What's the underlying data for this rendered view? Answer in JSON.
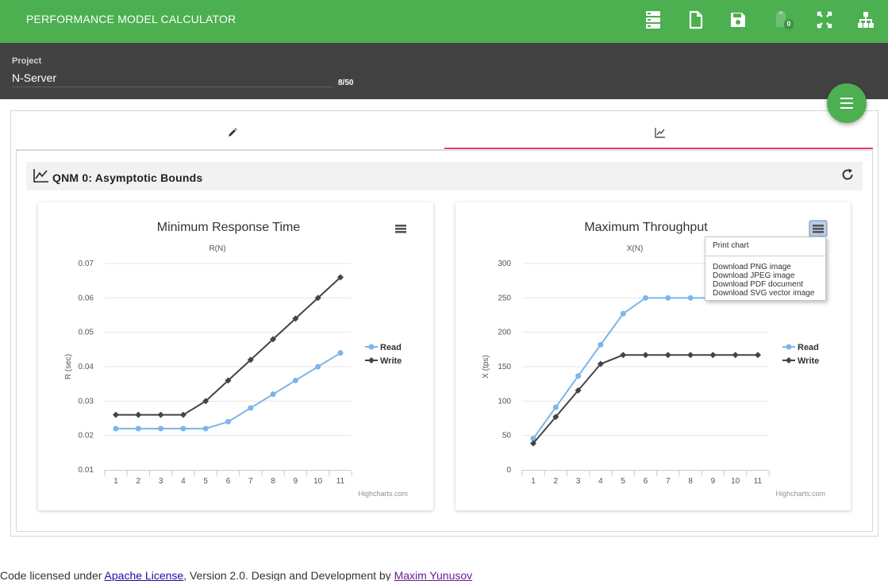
{
  "app": {
    "title": "PERFORMANCE MODEL CALCULATOR",
    "toolbar_icons": [
      "server-icon",
      "new-file-icon",
      "save-icon",
      "clipboard-icon",
      "fullscreen-icon",
      "sitemap-icon"
    ],
    "clipboard_count": "0"
  },
  "project": {
    "label": "Project",
    "value": "N-Server",
    "counter": "8/50"
  },
  "tabs": [
    {
      "icon": "pencil-icon",
      "active": false
    },
    {
      "icon": "line-chart-icon",
      "active": true
    }
  ],
  "section": {
    "title": "QNM 0: Asymptotic Bounds",
    "icon": "area-chart-icon"
  },
  "chart_menu": {
    "print": "Print chart",
    "downloads": [
      "Download PNG image",
      "Download JPEG image",
      "Download PDF document",
      "Download SVG vector image"
    ]
  },
  "chart_data": [
    {
      "type": "line",
      "title": "Minimum Response Time",
      "subtitle": "R(N)",
      "ylabel": "R (sec)",
      "xlabel": "",
      "x": [
        1,
        2,
        3,
        4,
        5,
        6,
        7,
        8,
        9,
        10,
        11
      ],
      "ylim": [
        0.01,
        0.07
      ],
      "yticks": [
        "0.01",
        "0.02",
        "0.03",
        "0.04",
        "0.05",
        "0.06",
        "0.07"
      ],
      "grid": true,
      "legend": "right",
      "credit": "Highcharts.com",
      "series": [
        {
          "name": "Read",
          "color": "#7cb5ec",
          "marker": "circle",
          "values": [
            0.022,
            0.022,
            0.022,
            0.022,
            0.022,
            0.024,
            0.028,
            0.032,
            0.036,
            0.04,
            0.044
          ]
        },
        {
          "name": "Write",
          "color": "#434348",
          "marker": "diamond",
          "values": [
            0.026,
            0.026,
            0.026,
            0.026,
            0.03,
            0.036,
            0.042,
            0.048,
            0.054,
            0.06,
            0.066
          ]
        }
      ]
    },
    {
      "type": "line",
      "title": "Maximum Throughput",
      "subtitle": "X(N)",
      "ylabel": "X (tps)",
      "xlabel": "",
      "x": [
        1,
        2,
        3,
        4,
        5,
        6,
        7,
        8,
        9,
        10,
        11
      ],
      "ylim": [
        0,
        300
      ],
      "yticks": [
        "0",
        "50",
        "100",
        "150",
        "200",
        "250",
        "300"
      ],
      "grid": true,
      "legend": "right",
      "credit": "Highcharts.com",
      "series": [
        {
          "name": "Read",
          "color": "#7cb5ec",
          "marker": "circle",
          "values": [
            45.5,
            91,
            136.5,
            182,
            227,
            250,
            250,
            250,
            250,
            250,
            250
          ]
        },
        {
          "name": "Write",
          "color": "#434348",
          "marker": "diamond",
          "values": [
            38.5,
            77,
            115.5,
            154,
            167,
            167,
            167,
            167,
            167,
            167,
            167
          ]
        }
      ]
    }
  ],
  "footer": {
    "prefix": "Code licensed under ",
    "license_link": "Apache License",
    "middle": ", Version 2.0. Design and Development by ",
    "author_link": "Maxim Yunusov"
  },
  "colors": {
    "primary": "#4caf50",
    "dark_bar": "#424242",
    "tab_indicator": "#e0397e"
  }
}
